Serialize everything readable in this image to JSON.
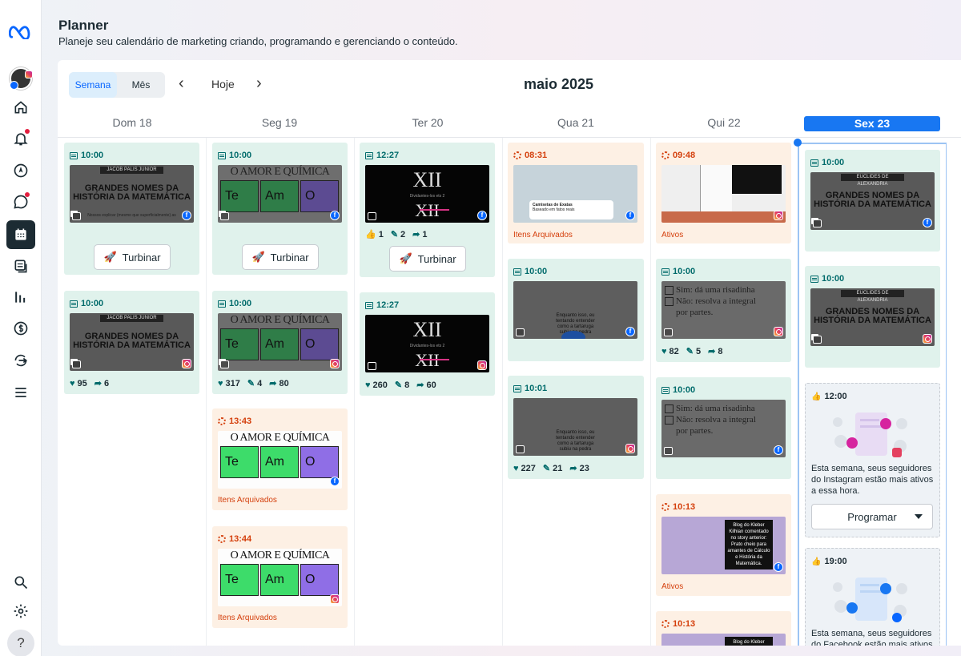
{
  "header": {
    "title": "Planner",
    "subtitle": "Planeje seu calendário de marketing criando, programando e gerenciando o conteúdo."
  },
  "sidebar": {
    "items": [
      {
        "name": "meta-logo",
        "icon": "meta-logo"
      },
      {
        "name": "account-avatar",
        "icon": "avatar"
      },
      {
        "name": "home",
        "icon": "home-icon"
      },
      {
        "name": "notifications",
        "icon": "bell-icon",
        "badge": true
      },
      {
        "name": "navigation",
        "icon": "compass-icon"
      },
      {
        "name": "messages",
        "icon": "chat-icon",
        "badge": true
      },
      {
        "name": "planner",
        "icon": "calendar-icon",
        "active": true
      },
      {
        "name": "content",
        "icon": "content-icon"
      },
      {
        "name": "insights",
        "icon": "bar-chart-icon"
      },
      {
        "name": "monetization",
        "icon": "dollar-icon"
      },
      {
        "name": "ads",
        "icon": "ads-icon"
      },
      {
        "name": "menu",
        "icon": "menu-icon"
      },
      {
        "name": "search",
        "icon": "search-icon"
      },
      {
        "name": "settings",
        "icon": "gear-icon"
      },
      {
        "name": "help",
        "icon": "help-icon",
        "label": "?"
      }
    ]
  },
  "toolbar": {
    "week_label": "Semana",
    "month_label": "Mês",
    "today_label": "Hoje",
    "prev": "‹",
    "next": "›",
    "month_title": "maio 2025"
  },
  "days": [
    "Dom 18",
    "Seg 19",
    "Ter 20",
    "Qua 21",
    "Qui 22",
    "Sex 23"
  ],
  "common": {
    "boost": "Turbinar",
    "archived": "Itens Arquivados",
    "active": "Ativos",
    "schedule": "Programar"
  },
  "posts": {
    "d0p1": {
      "time": "10:00",
      "band": "JACOB PALIS JUNIOR",
      "headline": "GRANDES NOMES DA HISTÓRIA DA MATEMÁTICA",
      "caption": "Nossos explicar (mesmo que superficialmente) as"
    },
    "d0p2": {
      "time": "10:00",
      "band": "JACOB PALIS JUNIOR",
      "headline": "GRANDES NOMES DA HISTÓRIA DA MATEMÁTICA",
      "likes": "95",
      "shares": "6"
    },
    "d1p1": {
      "time": "10:00",
      "headline": "O AMOR E QUÍMICA PURA"
    },
    "d1p2": {
      "time": "10:00",
      "headline": "O AMOR E QUÍMICA PURA",
      "likes": "317",
      "comments": "4",
      "shares": "80"
    },
    "d1p3": {
      "time": "13:43",
      "headline": "O AMOR E QUÍMICA PURA"
    },
    "d1p4": {
      "time": "13:44",
      "headline": "O AMOR E QUÍMICA PURA"
    },
    "d2p1": {
      "time": "12:27",
      "roman": "XII",
      "line": "Dividantes-los ets 2",
      "likes": "1",
      "comments": "2",
      "shares": "1"
    },
    "d2p2": {
      "time": "12:27",
      "roman": "XII",
      "line": "Dividantes-los ets 2",
      "likes": "260",
      "comments": "8",
      "shares": "60"
    },
    "d3p1": {
      "time": "08:31",
      "caption": "Camisetas de Exatas",
      "sub": "Baseado em fatos reais"
    },
    "d3p2": {
      "time": "10:00",
      "caption": "Enquanto isso, eu tentando entender como a tartaruga subiu na pedra"
    },
    "d3p3": {
      "time": "10:01",
      "caption": "Enquanto isso, eu tentando entender como a tartaruga subiu na pedra",
      "likes": "227",
      "comments": "21",
      "shares": "23"
    },
    "d4p1": {
      "time": "09:48"
    },
    "d4p2": {
      "time": "10:00",
      "opt1": "Sim: dá uma risadinha",
      "opt2": "Não: resolva a integral por partes.",
      "likes": "82",
      "comments": "5",
      "shares": "8"
    },
    "d4p3": {
      "time": "10:00",
      "opt1": "Sim: dá uma risadinha",
      "opt2": "Não: resolva a integral por partes."
    },
    "d4p4": {
      "time": "10:13",
      "box": "Blog do Kleber Kilhian comentado no story anterior: Prato cheio para amantes de Cálculo e História da Matemática."
    },
    "d4p5": {
      "time": "10:13",
      "box": "Blog do Kleber Kilhian comentado"
    },
    "d5p1": {
      "time": "10:00",
      "band": "EUCLIDES DE ALEXANDRIA",
      "headline": "GRANDES NOMES DA HISTÓRIA DA MATEMÁTICA"
    },
    "d5p2": {
      "time": "10:00",
      "band": "EUCLIDES DE ALEXANDRIA",
      "headline": "GRANDES NOMES DA HISTÓRIA DA MATEMÁTICA"
    },
    "d5s1": {
      "time": "12:00",
      "text": "Esta semana, seus seguidores do Instagram estão mais ativos a essa hora."
    },
    "d5s2": {
      "time": "19:00",
      "text": "Esta semana, seus seguidores do Facebook estão mais ativos"
    }
  },
  "colors": {
    "accent": "#0866ff",
    "teal": "#006b6b",
    "orange": "#d43f0c",
    "green_card": "#e0f2ec",
    "orange_card": "#fdf0e4"
  }
}
